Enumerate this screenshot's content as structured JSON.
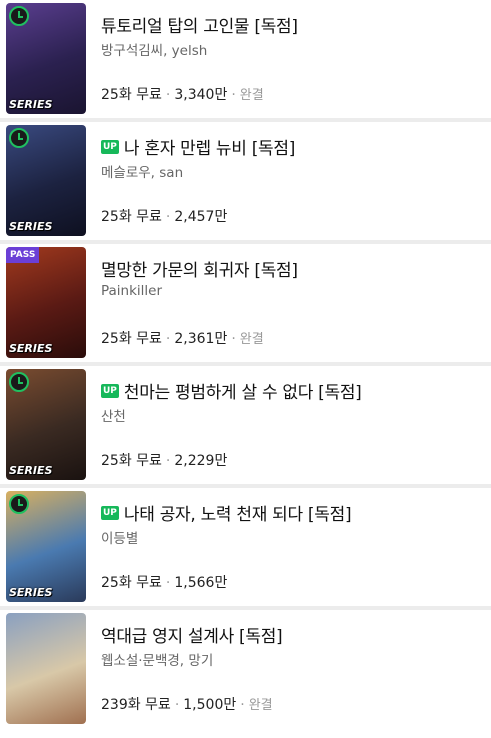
{
  "items": [
    {
      "badge": "clock",
      "up": false,
      "title": "튜토리얼 탑의 고인물 [독점]",
      "author": "방구석김씨, yelsh",
      "episodes": "25화 무료",
      "views": "3,340만",
      "status": "완결",
      "series_tag": "SERIES",
      "cover_text": "",
      "cover_colors": [
        "#2b2150",
        "#5a3e8f",
        "#1a1430"
      ]
    },
    {
      "badge": "clock",
      "up": true,
      "up_label": "UP",
      "title": "나 혼자 만렙 뉴비 [독점]",
      "author": "메슬로우, san",
      "episodes": "25화 무료",
      "views": "2,457만",
      "status": "",
      "series_tag": "SERIES",
      "cover_text": "",
      "cover_colors": [
        "#1c2240",
        "#3a4a80",
        "#0e1020"
      ]
    },
    {
      "badge": "pass",
      "pass_label": "PASS",
      "up": false,
      "title": "멸망한 가문의 회귀자 [독점]",
      "author": "Painkiller",
      "episodes": "25화 무료",
      "views": "2,361만",
      "status": "완결",
      "series_tag": "SERIES",
      "cover_text": "",
      "cover_colors": [
        "#5a1a14",
        "#a23a1e",
        "#2a0c0a"
      ]
    },
    {
      "badge": "clock",
      "up": true,
      "up_label": "UP",
      "title": "천마는 평범하게 살 수 없다 [독점]",
      "author": "산천",
      "episodes": "25화 무료",
      "views": "2,229만",
      "status": "",
      "series_tag": "SERIES",
      "cover_text": "",
      "cover_colors": [
        "#3a2a22",
        "#7a4c30",
        "#1a1210"
      ]
    },
    {
      "badge": "clock",
      "up": true,
      "up_label": "UP",
      "title": "나태 공자, 노력 천재 되다 [독점]",
      "author": "이등별",
      "episodes": "25화 무료",
      "views": "1,566만",
      "status": "",
      "series_tag": "SERIES",
      "cover_text": "",
      "cover_colors": [
        "#4a7ab0",
        "#d8b060",
        "#2a3a5a"
      ]
    },
    {
      "badge": "",
      "up": false,
      "title": "역대급 영지 설계사 [독점]",
      "author": "웹소설·문백경, 망기",
      "episodes": "239화 무료",
      "views": "1,500만",
      "status": "완결",
      "series_tag": "",
      "cover_text": "",
      "cover_colors": [
        "#d8c8a8",
        "#8aa0c0",
        "#a07050"
      ]
    }
  ]
}
